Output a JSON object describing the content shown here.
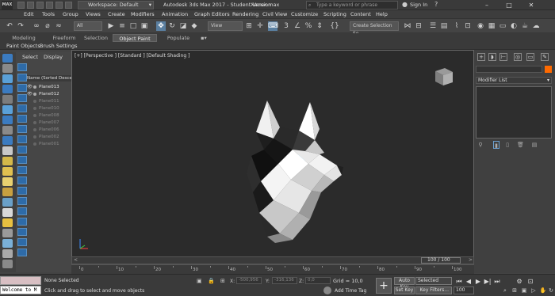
{
  "titlebar": {
    "app_icon": "MAX",
    "workspace_label": "Workspace: Default",
    "app_title": "Autodesk 3ds Max 2017 - Student Version",
    "document": "Хаски.max",
    "search_placeholder": "Type a keyword or phrase",
    "signin": "Sign In",
    "controls": [
      "–",
      "□",
      "✕"
    ]
  },
  "menu": [
    "Edit",
    "Tools",
    "Group",
    "Views",
    "Create",
    "Modifiers",
    "Animation",
    "Graph Editors",
    "Rendering",
    "Civil View",
    "Customize",
    "Scripting",
    "Content",
    "Help"
  ],
  "toolbar": {
    "selection_filter": "All",
    "ref_coord": "View",
    "named_selection": "Create Selection Se"
  },
  "ribbon": {
    "tabs": [
      "Modeling",
      "Freeform",
      "Selection",
      "Object Paint",
      "Populate"
    ],
    "active_tab": "Object Paint",
    "sub": [
      "Paint Objects",
      "Brush Settings"
    ]
  },
  "scene_explorer": {
    "tabs": [
      "Select",
      "Display"
    ],
    "header": "Name (Sorted Descen",
    "objects": [
      {
        "name": "Plane013",
        "visible": true,
        "active": true
      },
      {
        "name": "Plane012",
        "visible": true,
        "active": true
      },
      {
        "name": "Plane011",
        "visible": false,
        "active": false
      },
      {
        "name": "Plane010",
        "visible": false,
        "active": false
      },
      {
        "name": "Plane008",
        "visible": false,
        "active": false
      },
      {
        "name": "Plane007",
        "visible": false,
        "active": false
      },
      {
        "name": "Plane006",
        "visible": false,
        "active": false
      },
      {
        "name": "Plane002",
        "visible": false,
        "active": false
      },
      {
        "name": "Plane001",
        "visible": false,
        "active": false
      }
    ]
  },
  "viewport": {
    "label": "[+] [Perspective ] [Standard ] [Default Shading ]"
  },
  "time_slider": {
    "label": "100 / 100",
    "ticks": [
      0,
      10,
      20,
      30,
      40,
      50,
      60,
      70,
      80,
      90,
      100
    ]
  },
  "command_panel": {
    "modifier_list": "Modifier List",
    "color_swatch": "#ff6a00"
  },
  "status": {
    "maxscript_input": "",
    "welcome": "Welcome to M",
    "selection": "None Selected",
    "hint": "Click and drag to select and move objects",
    "x_label": "X:",
    "x_value": "-500,956",
    "y_label": "Y:",
    "y_value": "-316,136",
    "z_label": "Z:",
    "z_value": "0,0",
    "grid": "Grid = 10,0",
    "add_time_tag": "Add Time Tag",
    "auto_key": "Auto Key",
    "set_key": "Set Key",
    "selected": "Selected",
    "key_filters": "Key Filters...",
    "frame": "100"
  }
}
